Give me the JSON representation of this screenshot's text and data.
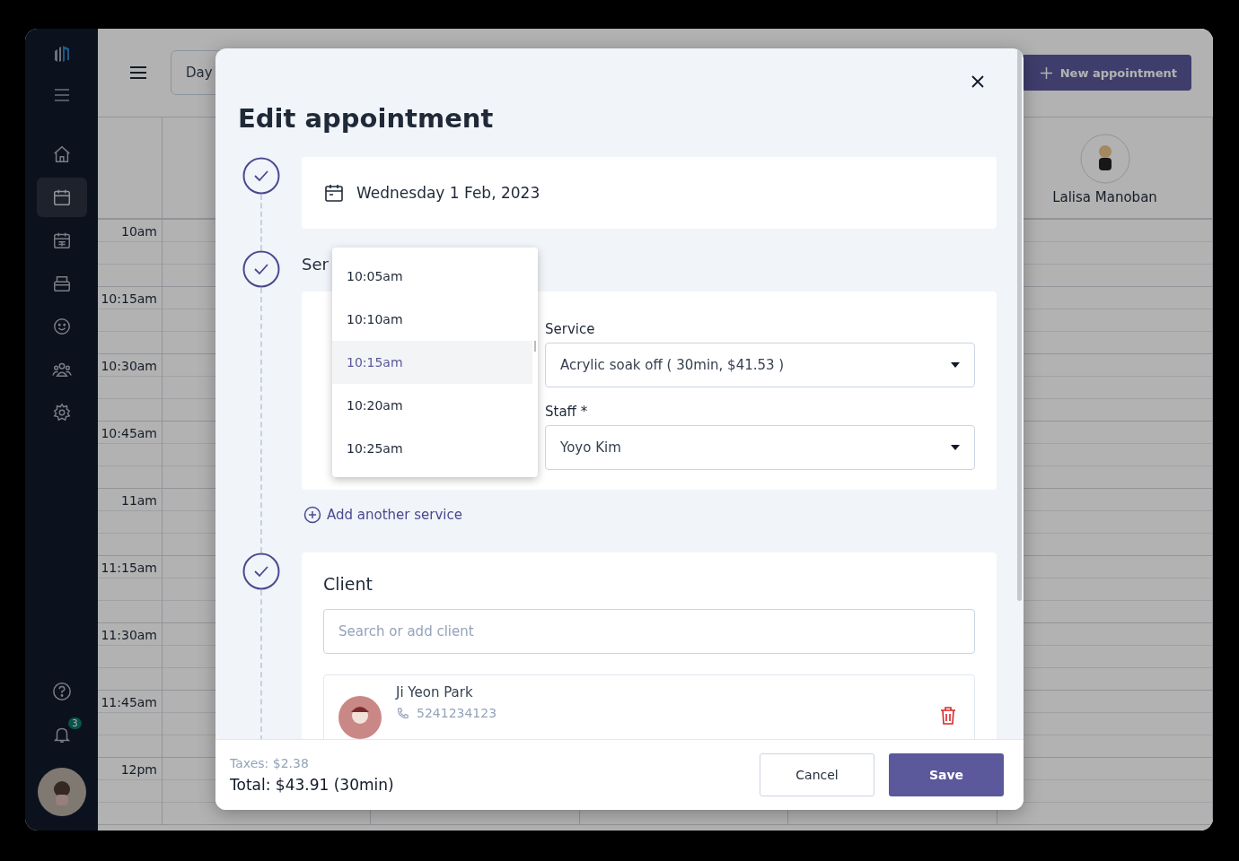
{
  "sidebar": {
    "items": [
      {
        "selected": false
      },
      {
        "selected": true
      },
      {
        "selected": false
      },
      {
        "selected": false
      },
      {
        "selected": false
      },
      {
        "selected": false
      },
      {
        "selected": false
      }
    ],
    "notification_badge": "3"
  },
  "toolbar": {
    "view": "Day",
    "new_button": "New appointment"
  },
  "staff_column": {
    "name": "Lalisa Manoban"
  },
  "time_slots": [
    "10am",
    "10:15am",
    "10:30am",
    "10:45am",
    "11am",
    "11:15am",
    "11:30am",
    "11:45am",
    "12pm"
  ],
  "modal": {
    "title": "Edit appointment",
    "date": "Wednesday 1 Feb, 2023",
    "services_heading": "Ser",
    "time_options": [
      {
        "label": "10:05am",
        "selected": false
      },
      {
        "label": "10:10am",
        "selected": false
      },
      {
        "label": "10:15am",
        "selected": true
      },
      {
        "label": "10:20am",
        "selected": false
      },
      {
        "label": "10:25am",
        "selected": false
      }
    ],
    "service": {
      "label": "Service",
      "value": "Acrylic soak off ( 30min, $41.53 )"
    },
    "staff": {
      "label": "Staff *",
      "value": "Yoyo Kim"
    },
    "add_service": "Add another service",
    "client_heading": "Client",
    "client_search": {
      "placeholder": "Search or add client"
    },
    "client": {
      "name": "Ji Yeon Park",
      "phone": "5241234123"
    },
    "taxes": "Taxes: $2.38",
    "total": "Total: $43.91 (30min)",
    "cancel": "Cancel",
    "save": "Save"
  }
}
